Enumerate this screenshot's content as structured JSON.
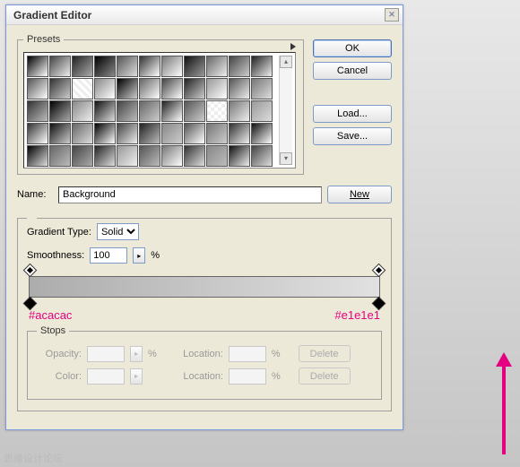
{
  "title": "Gradient Editor",
  "presets": {
    "legend": "Presets"
  },
  "buttons": {
    "ok": "OK",
    "cancel": "Cancel",
    "load": "Load...",
    "save": "Save...",
    "new": "New",
    "delete": "Delete"
  },
  "name": {
    "label": "Name:",
    "value": "Background"
  },
  "gradient": {
    "type_label": "Gradient Type:",
    "type_value": "Solid",
    "smooth_label": "Smoothness:",
    "smooth_value": "100",
    "percent": "%"
  },
  "colors": {
    "left": "#acacac",
    "right": "#e1e1e1"
  },
  "stops": {
    "legend": "Stops",
    "opacity": "Opacity:",
    "color": "Color:",
    "location": "Location:"
  },
  "watermark": "思缘设计论坛"
}
